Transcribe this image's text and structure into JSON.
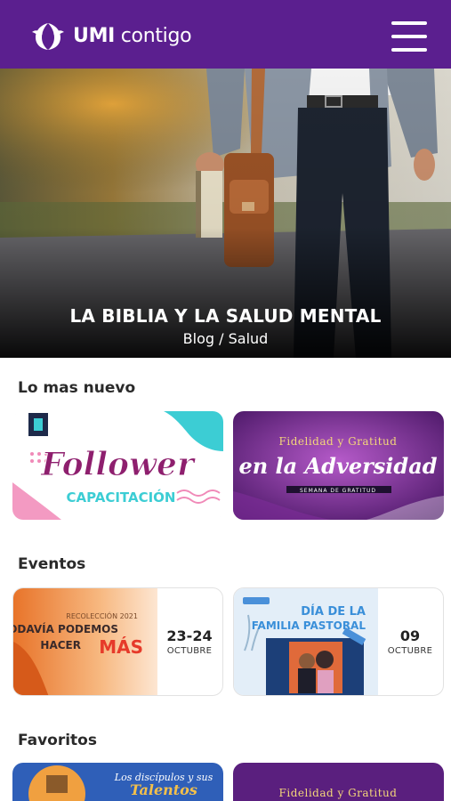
{
  "header": {
    "brand_bold": "UMI",
    "brand_light": "contigo",
    "menu_icon": "hamburger-menu-icon",
    "colors": {
      "primary": "#5b1f8f"
    }
  },
  "hero": {
    "title": "LA BIBLIA Y LA SALUD MENTAL",
    "subtitle": "Blog / Salud"
  },
  "sections": {
    "latest": {
      "title": "Lo mas nuevo",
      "cards": [
        {
          "line1": "Follower",
          "line2": "CAPACITACIÓN"
        },
        {
          "line1": "Fidelidad y Gratitud",
          "line2": "en la Adversidad",
          "line3": "SEMANA DE GRATITUD"
        }
      ]
    },
    "events": {
      "title": "Eventos",
      "items": [
        {
          "kicker": "RECOLECCIÓN 2021",
          "line1": "TODAVÍA PODEMOS",
          "line2": "HACER",
          "line3": "MÁS",
          "day": "23-24",
          "month": "OCTUBRE"
        },
        {
          "line1": "DÍA DE LA",
          "line2": "FAMILIA PASTORAL",
          "day": "09",
          "month": "OCTUBRE"
        }
      ]
    },
    "favorites": {
      "title": "Favoritos",
      "cards": [
        {
          "line1": "Los discípulos y sus",
          "line2": "Talentos"
        },
        {
          "line1": "Fidelidad y Gratitud"
        }
      ]
    }
  }
}
